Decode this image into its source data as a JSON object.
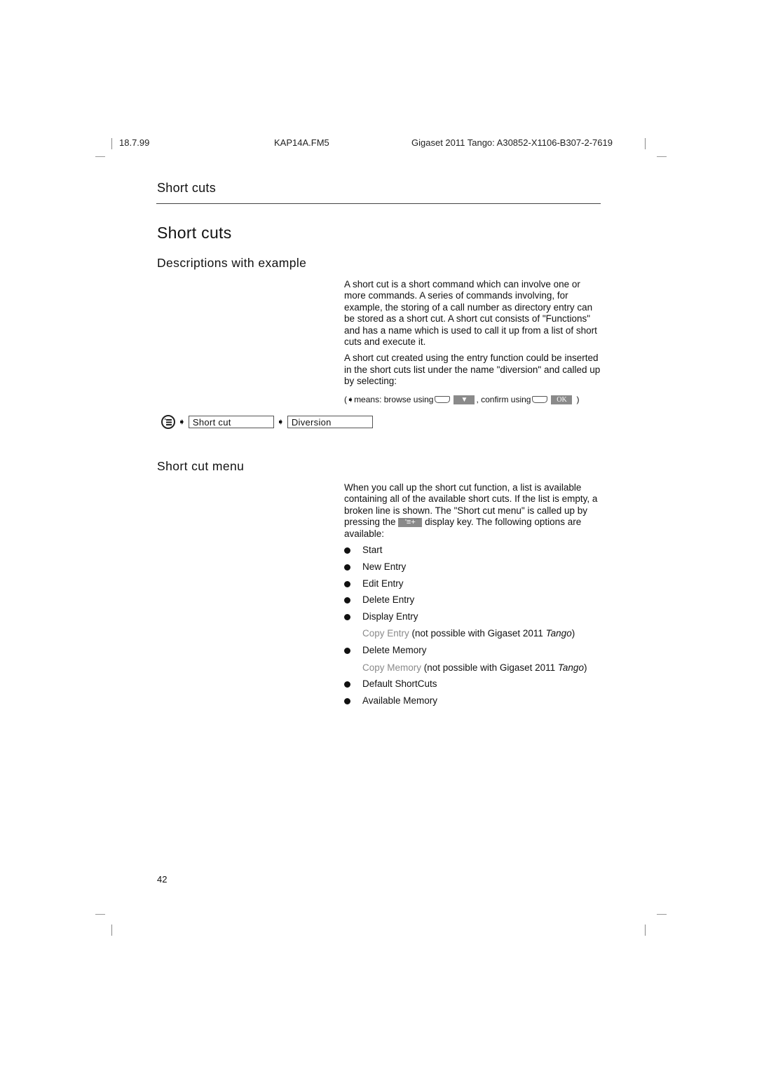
{
  "header": {
    "date": "18.7.99",
    "file": "KAP14A.FM5",
    "product": "Gigaset 2011 Tango: A30852-X1106-B307-2-7619"
  },
  "running_title": "Short cuts",
  "section_title": "Short cuts",
  "subsection1": {
    "title": "Descriptions with example",
    "para1": "A short cut is a short command which can involve one or more commands. A series of commands involving, for example, the storing of a call number as directory entry can be stored as a short cut. A short cut consists of \"Functions\" and has a name which is used to call it up from a list of short cuts and execute it.",
    "para2": "A short cut created using the entry function could be inserted in the short cuts list under the name \"diversion\" and called up by selecting:",
    "legend": {
      "open": "(",
      "arrow_glyph": "➧",
      "means": " means: browse using",
      "browse_key": "▼",
      "confirm": ", confirm using",
      "ok_key": "OK",
      "close": ")"
    },
    "path": {
      "menu_icon": "menu-key-icon",
      "arrow_glyph": "➧",
      "step1": "Short cut",
      "step2": "Diversion"
    }
  },
  "subsection2": {
    "title": "Short cut menu",
    "para_before_key": "When you call up the short cut function, a list is available containing all of the available short cuts. If the list is empty, a broken line is shown. The \"Short cut menu\" is called up by pressing the",
    "key_glyph": "'≡+",
    "para_after_key": "display key. The following options are available:",
    "options": [
      {
        "label": "Start",
        "bullet": true
      },
      {
        "label": "New Entry",
        "bullet": true
      },
      {
        "label": "Edit Entry",
        "bullet": true
      },
      {
        "label": "Delete Entry",
        "bullet": true
      },
      {
        "label": "Display Entry",
        "bullet": true
      },
      {
        "label": "Copy Entry",
        "bullet": false,
        "note_pre": " (not possible with Gigaset 2011 ",
        "note_em": "Tango",
        "note_post": ")"
      },
      {
        "label": "Delete Memory",
        "bullet": true
      },
      {
        "label": "Copy Memory",
        "bullet": false,
        "note_pre": " (not possible with Gigaset 2011 ",
        "note_em": "Tango",
        "note_post": ")"
      },
      {
        "label": "Default ShortCuts",
        "bullet": true
      },
      {
        "label": "Available Memory",
        "bullet": true
      }
    ]
  },
  "page_number": "42"
}
